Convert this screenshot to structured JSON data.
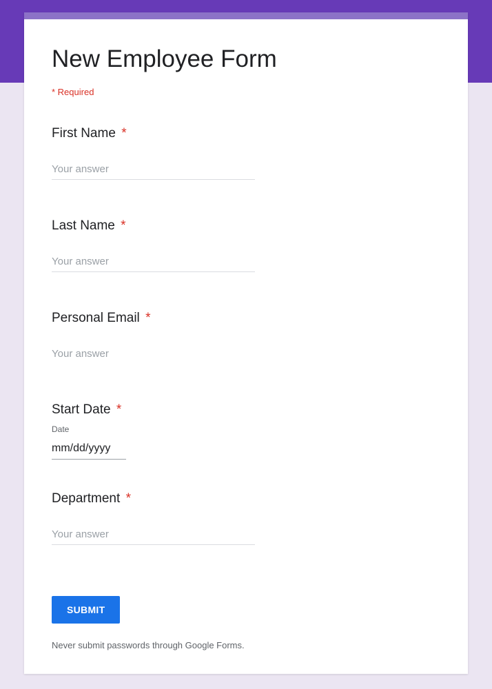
{
  "form": {
    "title": "New Employee Form",
    "required_note": "* Required",
    "fields": {
      "first_name": {
        "label": "First Name",
        "placeholder": "Your answer"
      },
      "last_name": {
        "label": "Last Name",
        "placeholder": "Your answer"
      },
      "personal_email": {
        "label": "Personal Email",
        "placeholder": "Your answer"
      },
      "start_date": {
        "label": "Start Date",
        "sub_label": "Date",
        "value": "mm/dd/yyyy"
      },
      "department": {
        "label": "Department",
        "placeholder": "Your answer"
      }
    },
    "asterisk": "*",
    "submit_label": "SUBMIT",
    "disclaimer": "Never submit passwords through Google Forms."
  }
}
